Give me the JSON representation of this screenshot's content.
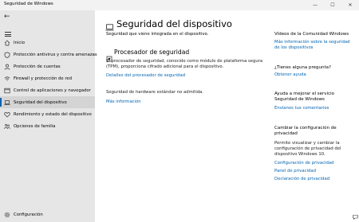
{
  "window": {
    "title": "Seguridad de Windows",
    "controls": [
      "—",
      "☐",
      "✕"
    ]
  },
  "sidebar": {
    "back_glyph": "←",
    "items": [
      {
        "label": "Inicio",
        "icon": "home-icon"
      },
      {
        "label": "Protección antivirus y contra amenazas",
        "icon": "shield-icon"
      },
      {
        "label": "Protección de cuentas",
        "icon": "person-icon"
      },
      {
        "label": "Firewall y protección de red",
        "icon": "wifi-icon"
      },
      {
        "label": "Control de aplicaciones y navegador",
        "icon": "app-browser-icon"
      },
      {
        "label": "Seguridad del dispositivo",
        "icon": "laptop-icon"
      },
      {
        "label": "Rendimiento y estado del dispositivo",
        "icon": "heart-icon"
      },
      {
        "label": "Opciones de familia",
        "icon": "family-icon"
      }
    ],
    "settings_label": "Configuración"
  },
  "main": {
    "title": "Seguridad del dispositivo",
    "subtitle": "Seguridad que viene integrada en el dispositivo.",
    "processor": {
      "heading": "Procesador de seguridad",
      "line1": "El procesador de seguridad, conocido como módulo de plataforma segura",
      "line2": "(TPM), proporciona cifrado adicional para el dispositivo.",
      "link": "Detalles del procesador de seguridad"
    },
    "standard": {
      "text": "Seguridad de hardware estándar no admitida.",
      "link": "Más información"
    }
  },
  "right": {
    "videos": {
      "title": "Vídeos de la Comunidad Windows",
      "link1": "Más información sobre la seguridad",
      "link2": "de los dispositivos"
    },
    "question": {
      "title": "¿Tienes alguna pregunta?",
      "link": "Obtener ayuda"
    },
    "improve": {
      "line1": "Ayuda a mejorar el servicio",
      "line2": "Seguridad de Windows",
      "link": "Envíanos tus comentarios"
    },
    "privacy": {
      "title1": "Cambiar la configuración de",
      "title2": "privacidad",
      "p1": "Permite visualizar y cambiar la",
      "p2": "configuración de privacidad del",
      "p3": "dispositivo Windows 10.",
      "link1": "Configuración de privacidad",
      "link2": "Panel de privacidad",
      "link3": "Declaración de privacidad"
    }
  },
  "colors": {
    "accent": "#0063b1",
    "sidebar_bg": "#e6e6e6",
    "active_bg": "#d4d4d4"
  }
}
